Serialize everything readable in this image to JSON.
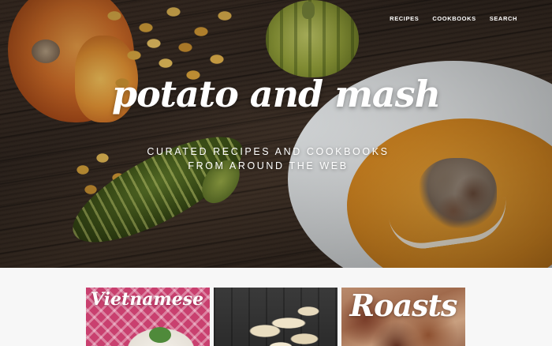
{
  "nav": {
    "items": [
      {
        "label": "RECIPES"
      },
      {
        "label": "COOKBOOKS"
      },
      {
        "label": "SEARCH"
      }
    ]
  },
  "hero": {
    "brand": "potato and mash",
    "tagline_line1": "CURATED RECIPES AND COOKBOOKS",
    "tagline_line2": "FROM AROUND THE WEB"
  },
  "cards": [
    {
      "title": "Vietnamese"
    },
    {
      "title": ""
    },
    {
      "title": "Roasts"
    }
  ],
  "colors": {
    "page_background": "#f7f7f7",
    "hero_text": "#ffffff",
    "nav_text": "#ffffff"
  }
}
